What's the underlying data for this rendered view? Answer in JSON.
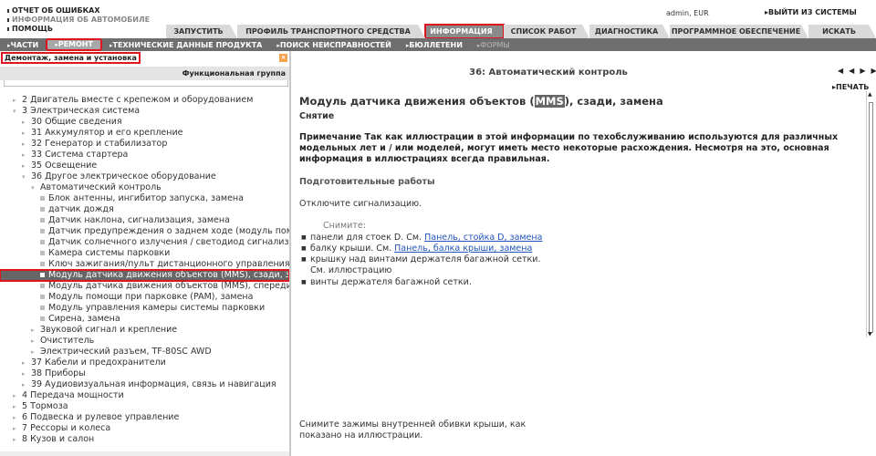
{
  "top_links": [
    "ОТЧЕТ ОБ ОШИБКАХ",
    "ИНФОРМАЦИЯ ОБ АВТОМОБИЛЕ",
    "ПОМОЩЬ"
  ],
  "user_info": "admin, EUR",
  "logout_label": "ВЫЙТИ ИЗ СИСТЕМЫ",
  "main_tabs": [
    {
      "label": "ЗАПУСТИТЬ"
    },
    {
      "label": "ПРОФИЛЬ ТРАНСПОРТНОГО СРЕДСТВА"
    },
    {
      "label": "ИНФОРМАЦИЯ"
    },
    {
      "label": "СПИСОК РАБОТ"
    },
    {
      "label": "ДИАГНОСТИКА"
    },
    {
      "label": "ПРОГРАММНОЕ ОБЕСПЕЧЕНИЕ"
    },
    {
      "label": "ИСКАТЬ"
    }
  ],
  "sub_nav": [
    {
      "label": "ЧАСТИ"
    },
    {
      "label": "РЕМОНТ"
    },
    {
      "label": "ТЕХНИЧЕСКИЕ ДАННЫЕ ПРОДУКТА"
    },
    {
      "label": "ПОИСК НЕИСПРАВНОСТЕЙ"
    },
    {
      "label": "БЮЛЛЕТЕНИ"
    },
    {
      "label": "ФОРМЫ"
    }
  ],
  "left_panel": {
    "title": "Демонтаж, замена и установка",
    "group_label": "Функциональная группа",
    "tree": [
      {
        "label": "2 Двигатель вместе с крепежом и оборудованием"
      },
      {
        "label": "3 Электрическая система"
      },
      {
        "label": "30 Общие сведения"
      },
      {
        "label": "31 Аккумулятор и его крепление"
      },
      {
        "label": "32 Генератор и стабилизатор"
      },
      {
        "label": "33 Система стартера"
      },
      {
        "label": "35 Освещение"
      },
      {
        "label": "36 Другое электрическое оборудование"
      },
      {
        "label": "Автоматический контроль"
      },
      {
        "label": "Блок антенны, ингибитор запуска, замена"
      },
      {
        "label": "датчик дождя"
      },
      {
        "label": "Датчик наклона, сигнализация, замена"
      },
      {
        "label": "Датчик предупреждения о заднем ходе (модуль помощи п"
      },
      {
        "label": "Датчик солнечного излучения / светодиод сигнализации,"
      },
      {
        "label": "Камера системы парковки"
      },
      {
        "label": "Ключ зажигания/пульт дистанционного управления, доб"
      },
      {
        "label": "Модуль датчика движения объектов (MMS), сзади, замена"
      },
      {
        "label": "Модуль датчика движения объектов (MMS), спереди, зам"
      },
      {
        "label": "Модуль помощи при парковке (PAM), замена"
      },
      {
        "label": "Модуль управления камеры системы парковки"
      },
      {
        "label": "Сирена, замена"
      },
      {
        "label": "Звуковой сигнал и крепление"
      },
      {
        "label": "Очиститель"
      },
      {
        "label": "Электрический разъем, TF-80SC AWD"
      },
      {
        "label": "37 Кабели и предохранители"
      },
      {
        "label": "38 Приборы"
      },
      {
        "label": "39 Аудиовизуальная информация, связь и навигация"
      },
      {
        "label": "4 Передача мощности"
      },
      {
        "label": "5 Тормоза"
      },
      {
        "label": "6 Подвеска и рулевое управление"
      },
      {
        "label": "7 Рессоры и колеса"
      },
      {
        "label": "8 Кузов и салон"
      }
    ]
  },
  "content": {
    "section_title": "36: Автоматический контроль",
    "print_label": "ПЕЧАТЬ",
    "doc_title_pre": "Модуль датчика движения объектов (",
    "doc_title_hl": "MMS",
    "doc_title_post": "), сзади, замена",
    "subtitle": "Снятие",
    "note": "Примечание Так как иллюстрации в этой информации по техобслуживанию используются для различных модельных лет и / или моделей, могут иметь место некоторые расхождения. Несмотря на это, основная информация в иллюстрациях всегда правильная.",
    "prep_title": "Подготовительные работы",
    "prep_text": "Отключите сигнализацию.",
    "remove_label": "Снимите:",
    "items": [
      {
        "text": "панели для стоек D. См. ",
        "link": "Панель, стойка D, замена"
      },
      {
        "text": "балку крыши. См. ",
        "link": "Панель, балка крыши, замена"
      },
      {
        "text": "крышку над винтами держателя багажной сетки.",
        "link": ""
      },
      {
        "text": "винты держателя багажной сетки.",
        "link": ""
      }
    ],
    "see_illustration": "См. иллюстрацию",
    "bottom_text": "Снимите зажимы внутренней обивки крыши, как показано на иллюстрации."
  }
}
